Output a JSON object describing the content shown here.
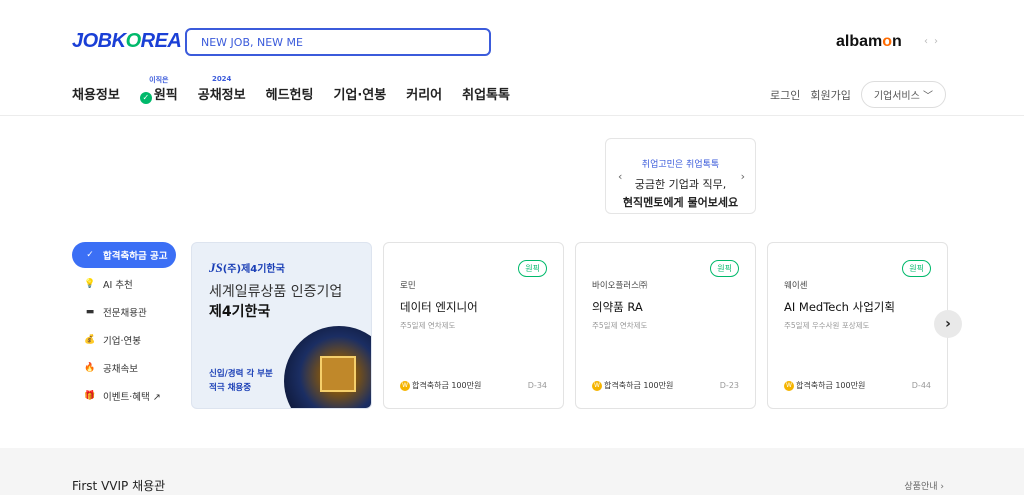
{
  "header": {
    "logo_main": "JOBK",
    "logo_o": "O",
    "logo_rest": "REA",
    "search_placeholder": "NEW JOB, NEW ME",
    "albamon_a": "albam",
    "albamon_o": "o",
    "albamon_n": "n",
    "brand_prev": "‹",
    "brand_next": "›"
  },
  "nav": {
    "items": [
      {
        "label": "채용정보",
        "sup": ""
      },
      {
        "label": "원픽",
        "sup": "이직은"
      },
      {
        "label": "공채정보",
        "sup": "2024"
      },
      {
        "label": "헤드헌팅",
        "sup": ""
      },
      {
        "label": "기업·연봉",
        "sup": ""
      },
      {
        "label": "커리어",
        "sup": ""
      },
      {
        "label": "취업톡톡",
        "sup": ""
      }
    ]
  },
  "util": {
    "login": "로그인",
    "signup": "회원가입",
    "biz_service": "기업서비스 ﹀"
  },
  "promo": {
    "line1": "취업고민은 취업톡톡",
    "line2": "궁금한 기업과 직무,",
    "line3": "현직멘토에게 물어보세요",
    "prev": "‹",
    "next": "›"
  },
  "sidebar": {
    "items": [
      {
        "label": "합격축하금 공고",
        "icon": "✓"
      },
      {
        "label": "AI 추천",
        "icon": "💡"
      },
      {
        "label": "전문채용관",
        "icon": "▬"
      },
      {
        "label": "기업·연봉",
        "icon": "💰"
      },
      {
        "label": "공채속보",
        "icon": "🔥"
      },
      {
        "label": "이벤트·혜택 ↗",
        "icon": "🎁"
      }
    ]
  },
  "banner": {
    "js": "JS",
    "company": "(주)제4기한국",
    "line1": "세계일류상품 인증기업",
    "line2": "제4기한국",
    "line3": "신입/경력 각 부분\n적극 채용중"
  },
  "cards": [
    {
      "badge": "원픽",
      "company": "로민",
      "title": "데이터 엔지니어",
      "meta": "주5일제  연차제도",
      "bonus": "합격축하금 100만원",
      "dday": "D-34"
    },
    {
      "badge": "원픽",
      "company": "바이오플러스㈜",
      "title": "의약품 RA",
      "meta": "주5일제  연차제도",
      "bonus": "합격축하금 100만원",
      "dday": "D-23"
    },
    {
      "badge": "원픽",
      "company": "웨이센",
      "title": "AI MedTech 사업기획",
      "meta": "주5일제  우수사원 포상제도",
      "bonus": "합격축하금 100만원",
      "dday": "D-44"
    }
  ],
  "next_arrow": "›",
  "coin_glyph": "W",
  "bottom": {
    "title": "First VVIP 채용관",
    "more": "상품안내 ›"
  },
  "colors": {
    "accent": "#3b5bdb",
    "active": "#3b6ff5",
    "badge": "#00b96b"
  }
}
